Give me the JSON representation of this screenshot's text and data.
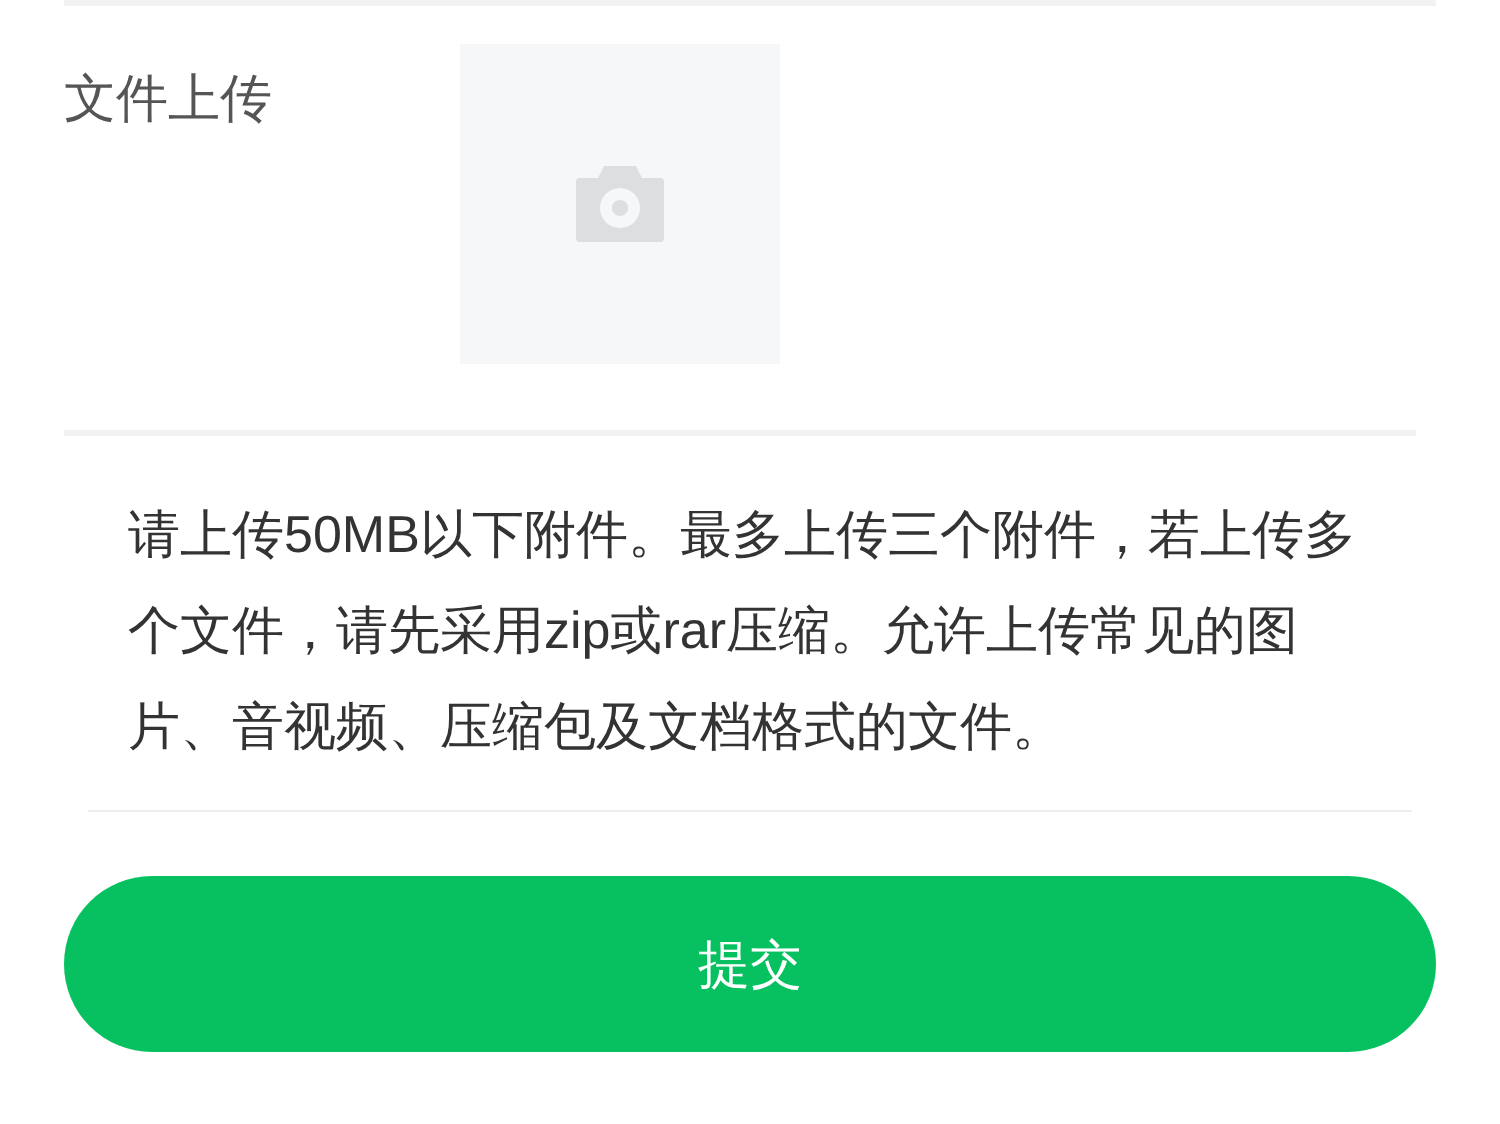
{
  "upload": {
    "label": "文件上传"
  },
  "notice": "请上传50MB以下附件。最多上传三个附件，若上传多个文件，请先采用zip或rar压缩。允许上传常见的图片、音视频、压缩包及文档格式的文件。",
  "submit_button": "提交"
}
